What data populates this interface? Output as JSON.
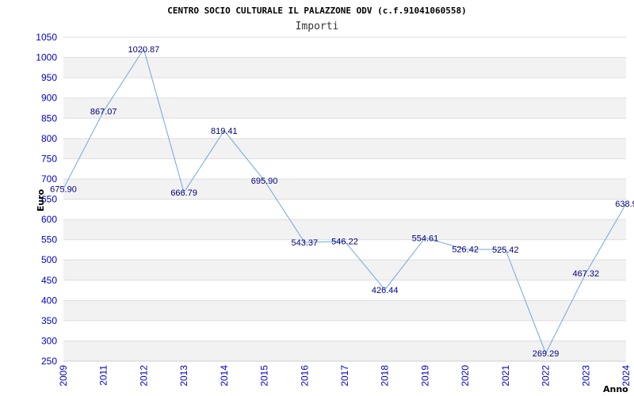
{
  "chart_data": {
    "type": "line",
    "title": "CENTRO SOCIO CULTURALE IL PALAZZONE ODV (c.f.91041060558)",
    "subtitle": "Importi",
    "xlabel": "Anno",
    "ylabel": "Euro",
    "x": [
      2009,
      2011,
      2012,
      2013,
      2014,
      2015,
      2016,
      2017,
      2018,
      2019,
      2020,
      2021,
      2022,
      2023,
      2024
    ],
    "x_tick_labels": [
      "2009",
      "2011",
      "2012",
      "2013",
      "2014",
      "2015",
      "2016",
      "2017",
      "2018",
      "2019",
      "2020",
      "2021",
      "2022",
      "2023",
      "2024"
    ],
    "values": [
      675.9,
      867.07,
      1020.87,
      666.79,
      819.41,
      695.9,
      543.37,
      546.22,
      426.44,
      554.61,
      526.42,
      525.42,
      269.29,
      467.32,
      638.9
    ],
    "data_labels": [
      "675.90",
      "867.07",
      "1020.87",
      "666.79",
      "819.41",
      "695.90",
      "543.37",
      "546.22",
      "426.44",
      "554.61",
      "526.42",
      "525.42",
      "269.29",
      "467.32",
      "638.9"
    ],
    "ylim": [
      250,
      1050
    ],
    "y_ticks": [
      250,
      300,
      350,
      400,
      450,
      500,
      550,
      600,
      650,
      700,
      750,
      800,
      850,
      900,
      950,
      1000,
      1050
    ],
    "grid": true,
    "line_color": "#6fa8dc",
    "band_color": "#f2f2f2",
    "tick_color": "#0000cc",
    "label_color": "#000080"
  }
}
